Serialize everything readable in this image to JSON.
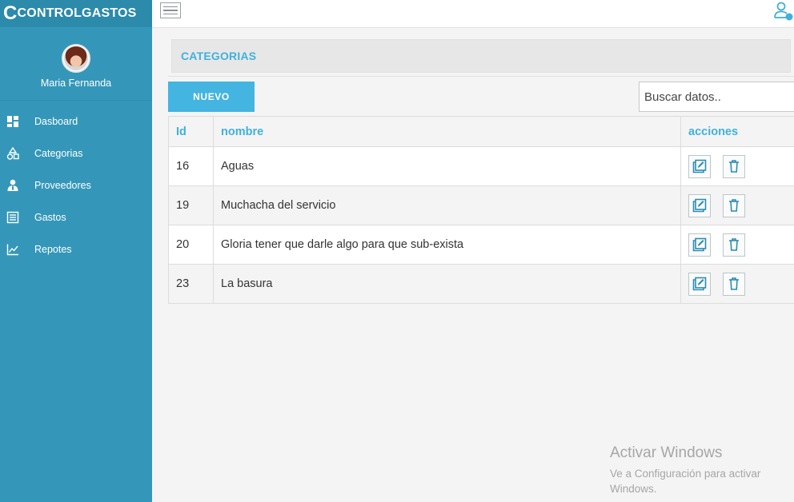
{
  "brand": {
    "first_letter": "C",
    "rest": "CONTROLGASTOS"
  },
  "user": {
    "name": "Maria Fernanda"
  },
  "sidebar": {
    "items": [
      {
        "label": "Dasboard",
        "icon": "dashboard-icon"
      },
      {
        "label": "Categorias",
        "icon": "shapes-icon"
      },
      {
        "label": "Proveedores",
        "icon": "user-tie-icon"
      },
      {
        "label": "Gastos",
        "icon": "list-icon"
      },
      {
        "label": "Repotes",
        "icon": "chart-line-icon"
      }
    ]
  },
  "page": {
    "title": "CATEGORIAS"
  },
  "toolbar": {
    "new_label": "NUEVO",
    "search_placeholder": "Buscar datos.."
  },
  "table": {
    "headers": [
      "Id",
      "nombre",
      "acciones"
    ],
    "rows": [
      {
        "id": "16",
        "nombre": "Aguas"
      },
      {
        "id": "19",
        "nombre": "Muchacha del servicio"
      },
      {
        "id": "20",
        "nombre": "Gloria tener que darle algo para que sub-exista"
      },
      {
        "id": "23",
        "nombre": "La basura"
      }
    ]
  },
  "watermark": {
    "line1": "Activar Windows",
    "line2": "Ve a Configuración para activar Windows."
  },
  "colors": {
    "sidebar": "#3497b9",
    "accent": "#44b4e0",
    "header_text": "#3fb1dc"
  }
}
